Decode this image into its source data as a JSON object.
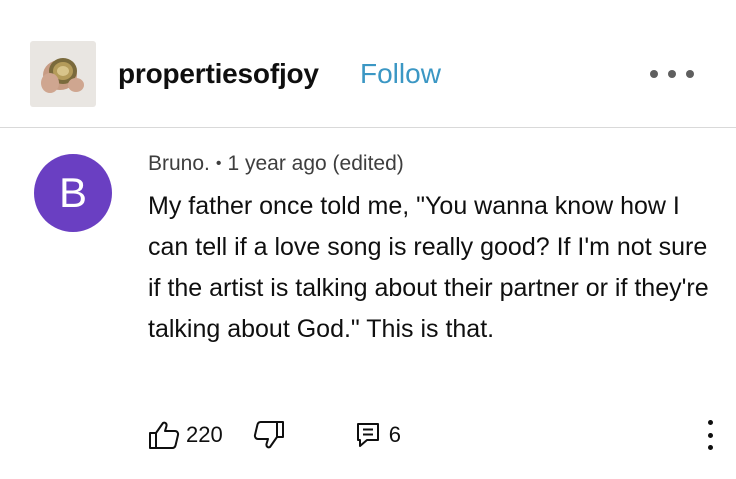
{
  "header": {
    "username": "propertiesofjoy",
    "follow_label": "Follow",
    "more_icon": "more-horizontal-icon"
  },
  "comment": {
    "avatar_letter": "B",
    "avatar_color": "#6a3fc2",
    "author": "Bruno.",
    "separator": "•",
    "timestamp": "1 year ago (edited)",
    "text": "My father once told me, \"You wanna know how I can tell if a love song is really good? If I'm not sure if the artist is talking about their partner or if they're talking about God.\" This is that.",
    "likes": "220",
    "replies": "6",
    "like_icon": "thumbs-up-icon",
    "dislike_icon": "thumbs-down-icon",
    "reply_icon": "reply-icon",
    "more_icon": "more-vertical-icon"
  },
  "colors": {
    "follow": "#3b97c4",
    "divider": "#d9d9d9"
  }
}
